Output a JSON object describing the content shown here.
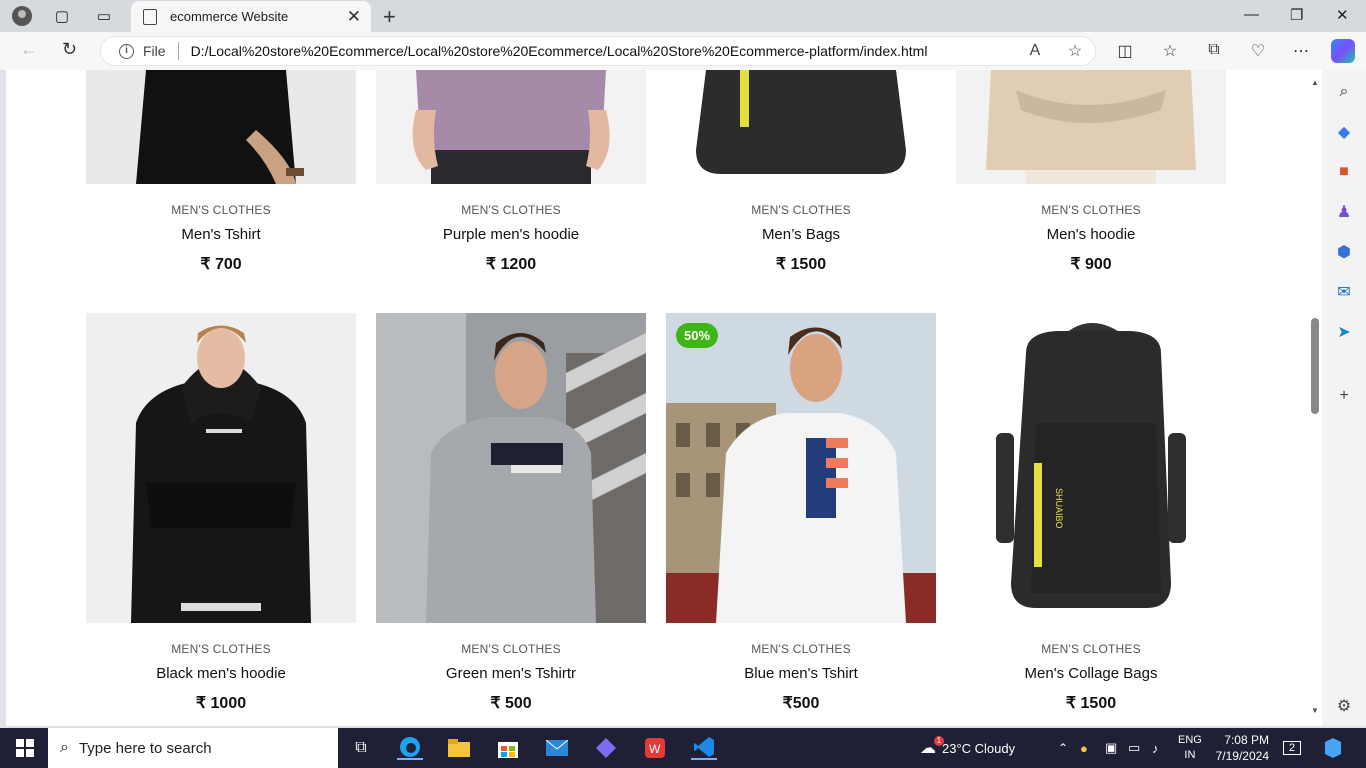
{
  "browser": {
    "tab_title": "ecommerce Website",
    "file_label": "File",
    "url": "D:/Local%20store%20Ecommerce/Local%20store%20Ecommerce/Local%20Store%20Ecommerce-platform/index.html"
  },
  "products_top": [
    {
      "category": "MEN'S CLOTHES",
      "name": "Men's Tshirt",
      "price": "₹ 700",
      "color": "#111"
    },
    {
      "category": "MEN'S CLOTHES",
      "name": "Purple men's hoodie",
      "price": "₹ 1200",
      "color": "#a68ba8"
    },
    {
      "category": "MEN'S CLOTHES",
      "name": "Men’s Bags",
      "price": "₹ 1500",
      "color": "#2b2b2b"
    },
    {
      "category": "MEN'S CLOTHES",
      "name": "Men's hoodie",
      "price": "₹ 900",
      "color": "#e0cdb4"
    }
  ],
  "products_bottom": [
    {
      "category": "MEN'S CLOTHES",
      "name": "Black men's hoodie",
      "price": "₹ 1000",
      "badge": ""
    },
    {
      "category": "MEN'S CLOTHES",
      "name": "Green men's Tshirtr",
      "price": "₹ 500",
      "badge": ""
    },
    {
      "category": "MEN'S CLOTHES",
      "name": "Blue men's Tshirt",
      "price": "₹500",
      "badge": "50%"
    },
    {
      "category": "MEN'S CLOTHES",
      "name": "Men's Collage Bags",
      "price": "₹ 1500",
      "badge": ""
    }
  ],
  "taskbar": {
    "search_placeholder": "Type here to search",
    "weather": "23°C  Cloudy",
    "lang_top": "ENG",
    "lang_bottom": "IN",
    "time": "7:08 PM",
    "date": "7/19/2024",
    "notifications": "2",
    "weather_alert": "1"
  }
}
